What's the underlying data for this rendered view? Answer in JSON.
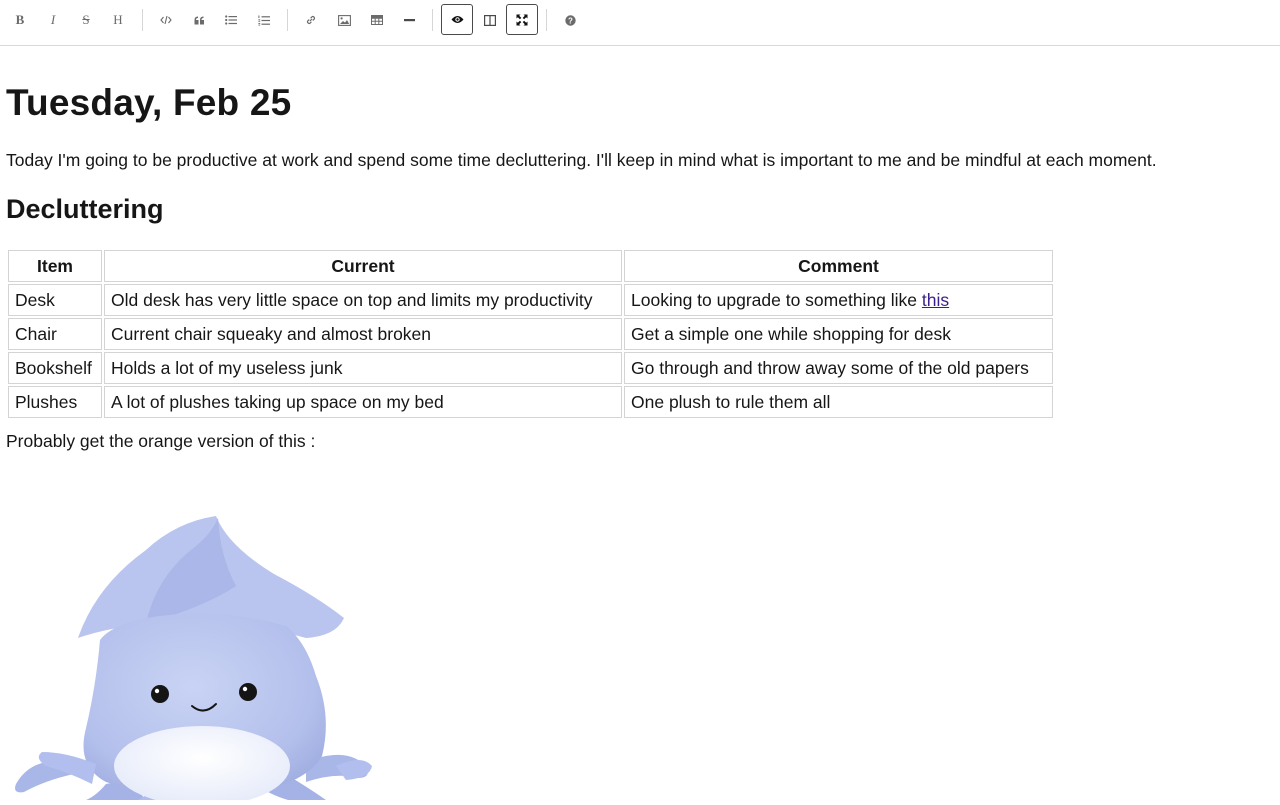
{
  "toolbar": {
    "buttons": [
      {
        "name": "bold",
        "glyph": "B"
      },
      {
        "name": "italic",
        "glyph": "I"
      },
      {
        "name": "strikethrough",
        "glyph": "S"
      },
      {
        "name": "heading",
        "glyph": "H"
      },
      {
        "name": "code",
        "icon": "code-icon"
      },
      {
        "name": "quote",
        "icon": "quote-icon"
      },
      {
        "name": "unordered-list",
        "icon": "list-ul-icon"
      },
      {
        "name": "ordered-list",
        "icon": "list-ol-icon"
      },
      {
        "name": "link",
        "icon": "link-icon"
      },
      {
        "name": "image",
        "icon": "image-icon"
      },
      {
        "name": "table",
        "icon": "table-icon"
      },
      {
        "name": "horizontal-rule",
        "icon": "minus-icon"
      },
      {
        "name": "preview",
        "icon": "eye-icon",
        "active": true
      },
      {
        "name": "side-by-side",
        "icon": "columns-icon"
      },
      {
        "name": "fullscreen",
        "icon": "arrows-alt-icon",
        "active": true
      },
      {
        "name": "guide",
        "icon": "question-circle-icon"
      }
    ]
  },
  "document": {
    "title": "Tuesday, Feb 25",
    "intro": "Today I'm going to be productive at work and spend some time decluttering. I'll keep in mind what is important to me and be mindful at each moment.",
    "section_heading": "Decluttering",
    "table": {
      "headers": [
        "Item",
        "Current",
        "Comment"
      ],
      "rows": [
        {
          "item": "Desk",
          "current": "Old desk has very little space on top and limits my productivity",
          "comment": "Looking to upgrade to something like ",
          "comment_link": "this"
        },
        {
          "item": "Chair",
          "current": "Current chair squeaky and almost broken",
          "comment": "Get a simple one while shopping for desk"
        },
        {
          "item": "Bookshelf",
          "current": "Holds a lot of my useless junk",
          "comment": "Go through and throw away some of the old papers"
        },
        {
          "item": "Plushes",
          "current": "A lot of plushes taking up space on my bed",
          "comment": "One plush to rule them all"
        }
      ]
    },
    "after_text": "Probably get the orange version of this :",
    "image": {
      "subject": "squid-plush",
      "color": "#b7c3ec"
    }
  },
  "colors": {
    "text": "#161616",
    "link": "#3a1f8a",
    "toolbar_icon": "#6b6b6b",
    "border": "#d4d4d4"
  }
}
